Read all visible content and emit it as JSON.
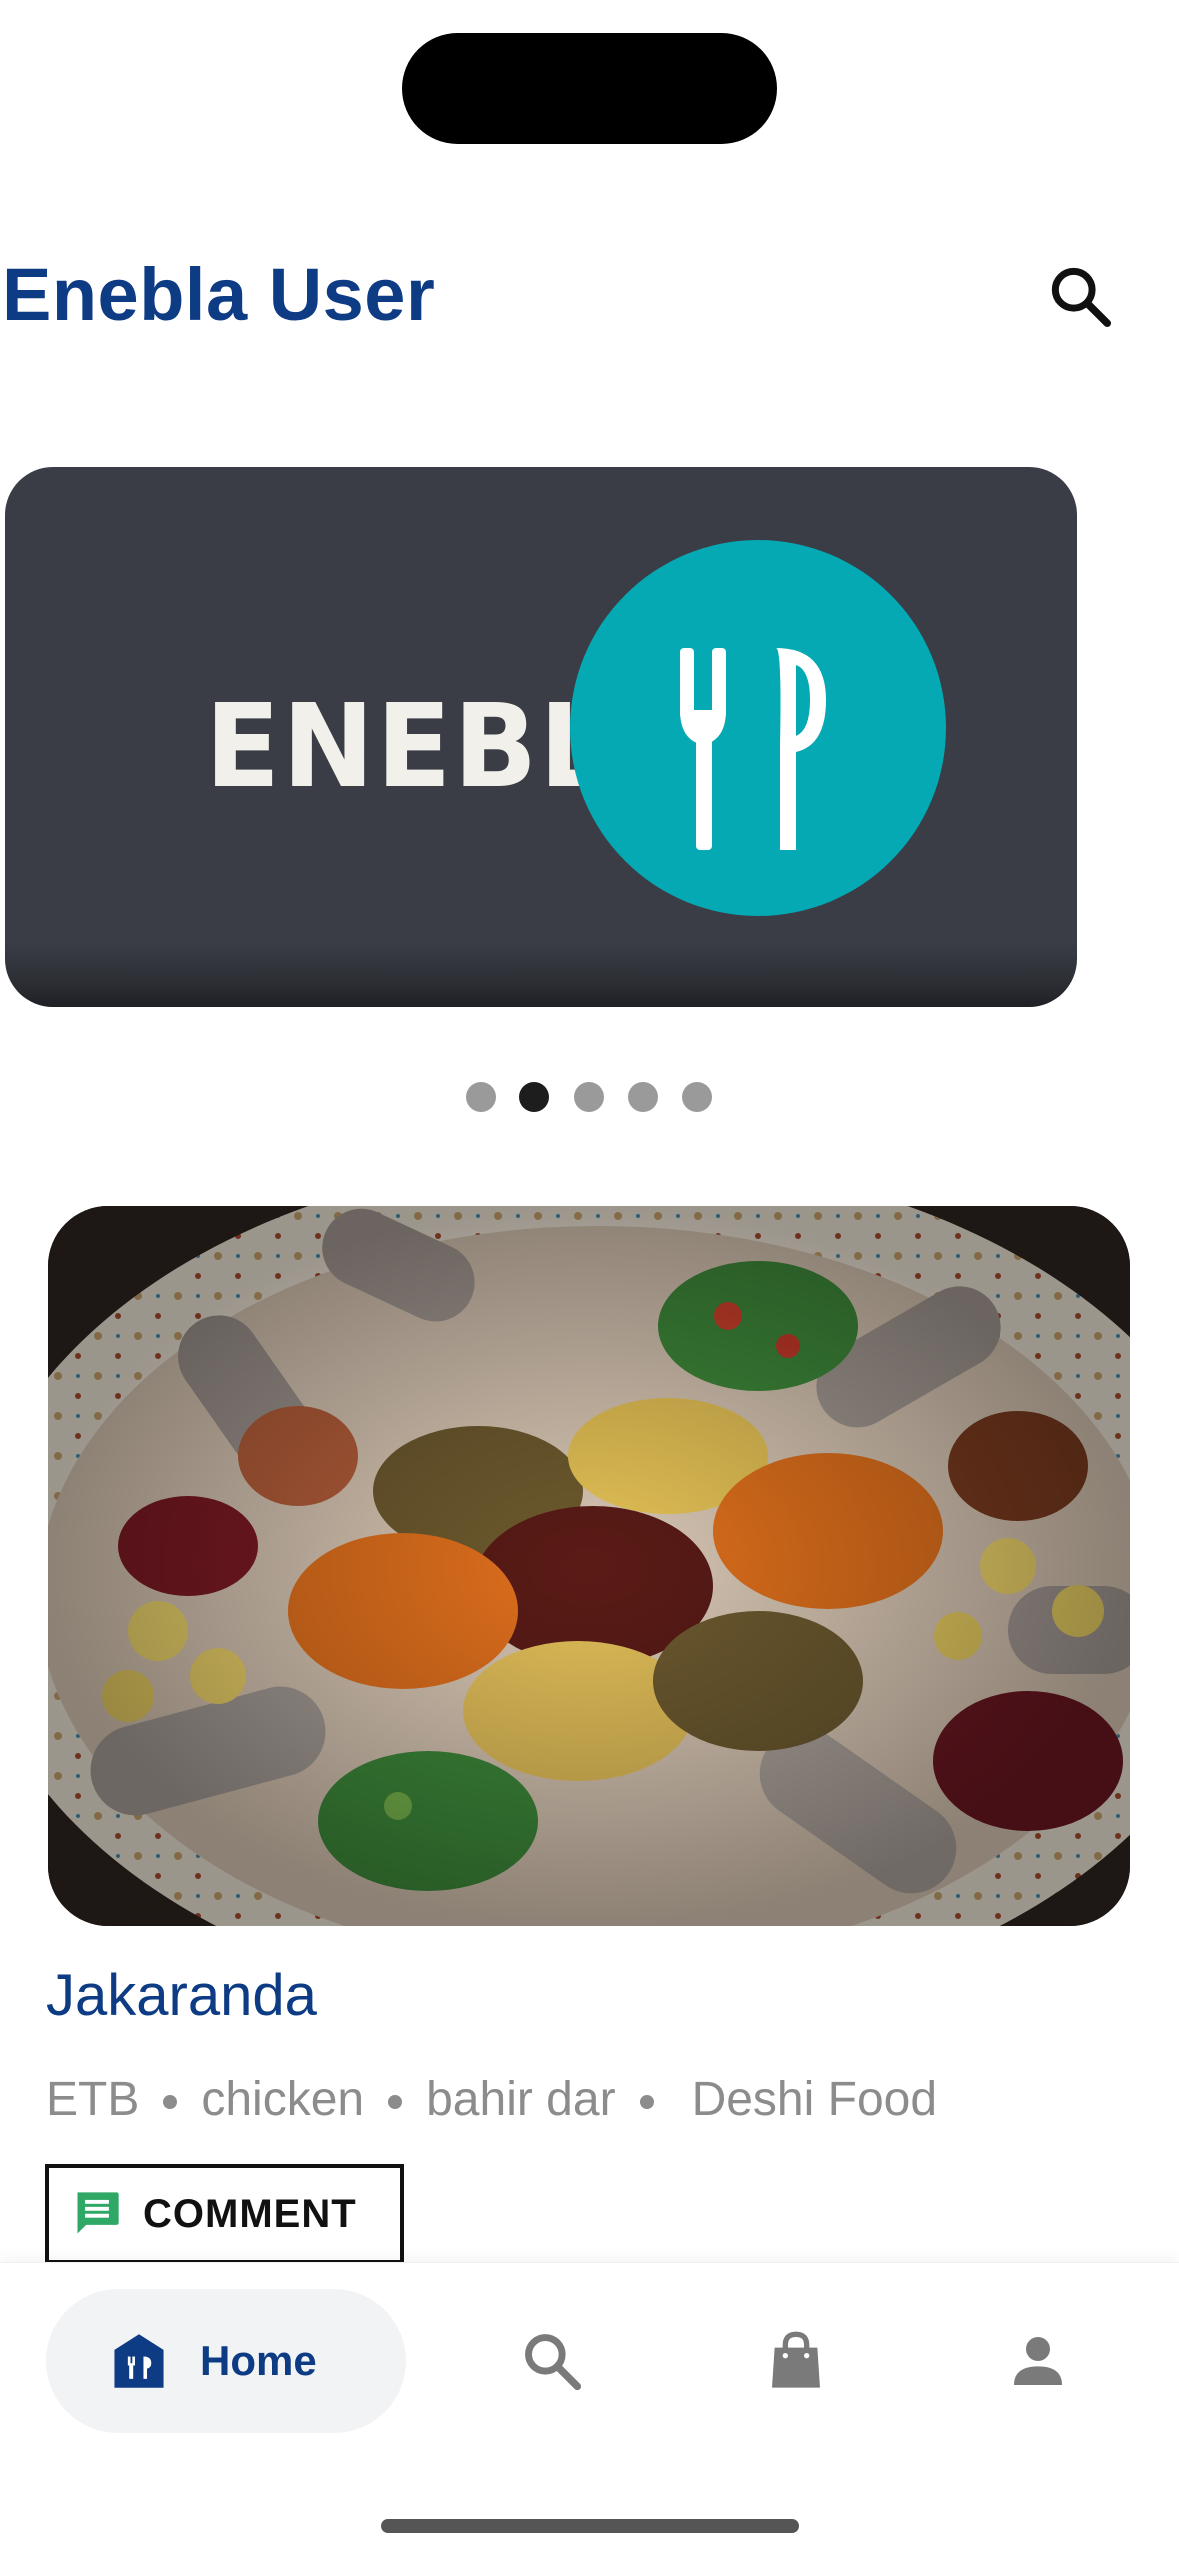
{
  "app": {
    "title": "Enebla User"
  },
  "banner": {
    "brand_text": "ENEBLA",
    "active_slide": 2,
    "slide_count": 5
  },
  "restaurant": {
    "name": "Jakaranda",
    "meta": [
      "ETB",
      "chicken",
      "bahir dar",
      "Deshi Food"
    ],
    "comment_label": "COMMENT"
  },
  "bottom_nav": {
    "home_label": "Home",
    "items": [
      {
        "icon": "home-icon",
        "label": "Home",
        "active": true
      },
      {
        "icon": "search-icon"
      },
      {
        "icon": "shopping-bag-icon"
      },
      {
        "icon": "profile-icon"
      }
    ]
  },
  "colors": {
    "brand_blue": "#0d3b84",
    "teal": "#05a9b4",
    "banner_bg": "#3a3d46",
    "comment_green": "#2fa866"
  }
}
